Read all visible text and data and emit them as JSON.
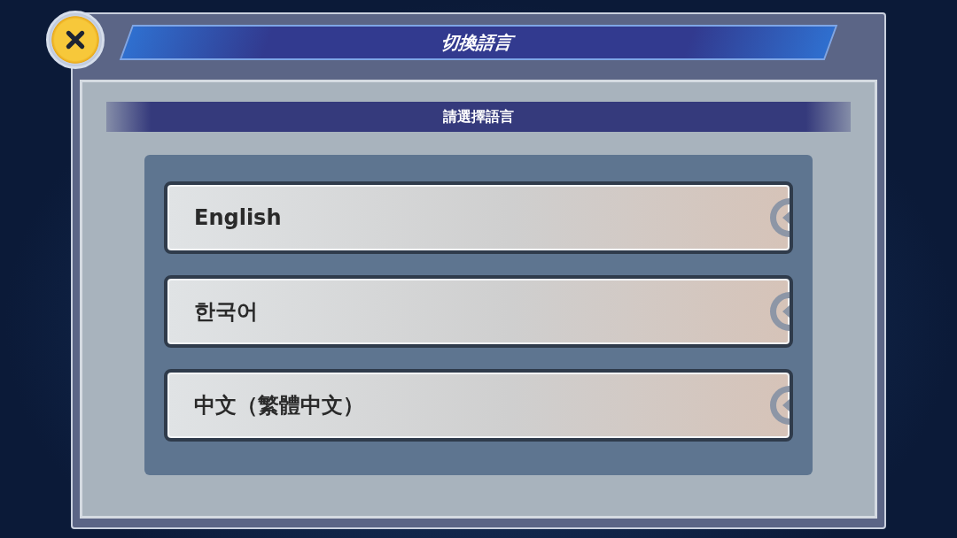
{
  "dialog": {
    "title": "切換語言",
    "subtitle": "請選擇語言"
  },
  "languages": [
    {
      "label": "English"
    },
    {
      "label": "한국어"
    },
    {
      "label": "中文（繁體中文）"
    }
  ]
}
